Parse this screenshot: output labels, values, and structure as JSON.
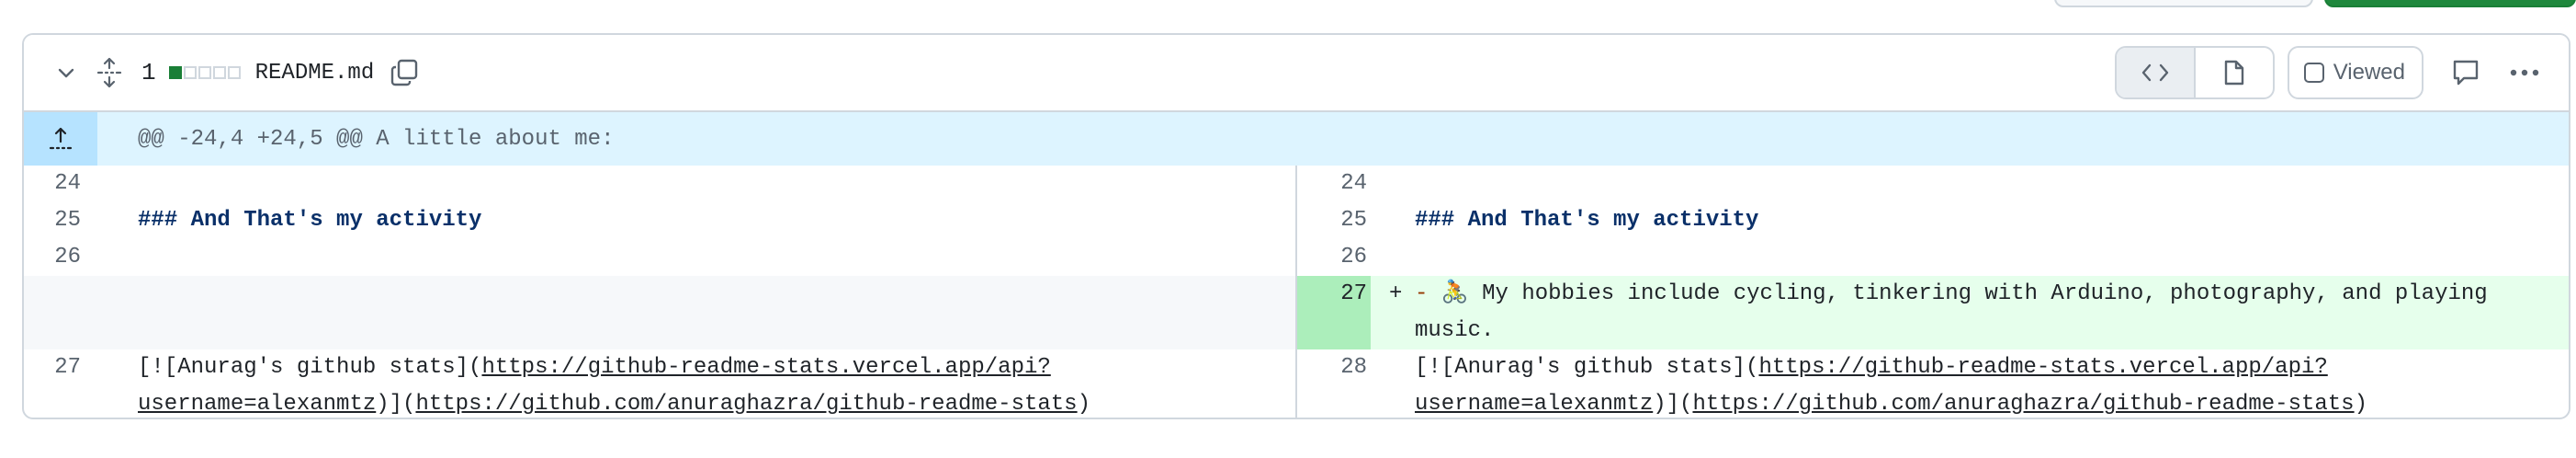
{
  "file": {
    "diff_count": "1",
    "stat_blocks": [
      "add",
      "neutral",
      "neutral",
      "neutral",
      "neutral"
    ],
    "filename": "README.md",
    "viewed_label": "Viewed",
    "icons": {
      "collapse": "chevron-down-icon",
      "expand_all": "unfold-icon",
      "copy": "copy-icon",
      "source_view": "code-icon",
      "rich_view": "file-icon",
      "comment": "comment-icon",
      "more": "kebab-horizontal-icon"
    }
  },
  "hunk": {
    "header": "@@ -24,4 +24,5 @@ A little about me:"
  },
  "rows": [
    {
      "left_num": "24",
      "left_text": "",
      "right_num": "24",
      "right_text": ""
    },
    {
      "left_num": "25",
      "left_text": "### And That's my activity",
      "right_num": "25",
      "right_text": "### And That's my activity"
    },
    {
      "left_num": "26",
      "left_text": "",
      "right_num": "26",
      "right_text": ""
    },
    {
      "left_num": "",
      "left_text": "",
      "right_num": "27",
      "right_marker": "+",
      "right_dash": "-",
      "right_emoji": "🚴",
      "right_text": "My hobbies include cycling, tinkering with Arduino, photography, and playing",
      "right_text_2": "music."
    },
    {
      "left_num": "27",
      "right_num": "28",
      "link_prefix": "[![Anurag's github stats](",
      "link_1a": "https://github-readme-stats.vercel.app/api?",
      "link_1b": "username=alexanmtz",
      "link_mid": ")](",
      "link_2": "https://github.com/anuraghazra/github-readme-stats",
      "link_end": ")"
    }
  ],
  "colors": {
    "border": "#d0d7de",
    "hunk_bg": "#ddf4ff",
    "add_bg": "#e6ffec",
    "add_num_bg": "#aceebb",
    "heading": "#0a3069"
  }
}
